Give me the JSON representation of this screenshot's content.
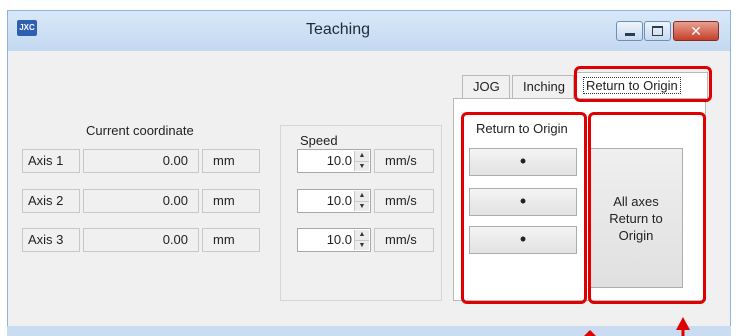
{
  "window": {
    "title": "Teaching",
    "app_icon_text": "JXC",
    "controls": {
      "close_glyph": "✕"
    }
  },
  "coordinate": {
    "label": "Current coordinate",
    "rows": [
      {
        "axis": "Axis 1",
        "value": "0.00",
        "unit": "mm"
      },
      {
        "axis": "Axis 2",
        "value": "0.00",
        "unit": "mm"
      },
      {
        "axis": "Axis 3",
        "value": "0.00",
        "unit": "mm"
      }
    ]
  },
  "speed": {
    "label": "Speed",
    "rows": [
      {
        "value": "10.0",
        "unit": "mm/s"
      },
      {
        "value": "10.0",
        "unit": "mm/s"
      },
      {
        "value": "10.0",
        "unit": "mm/s"
      }
    ],
    "spin_up": "▲",
    "spin_down": "▼"
  },
  "tabs": [
    "JOG",
    "Inching",
    "Return to Origin"
  ],
  "active_tab": "Return to Origin",
  "return_panel": {
    "label": "Return to Origin",
    "button_glyph": "•",
    "all_axes_label": "All axes\nReturn to\nOrigin"
  },
  "colors": {
    "highlight": "#e00000",
    "titlebar": "#c3d9f1"
  }
}
